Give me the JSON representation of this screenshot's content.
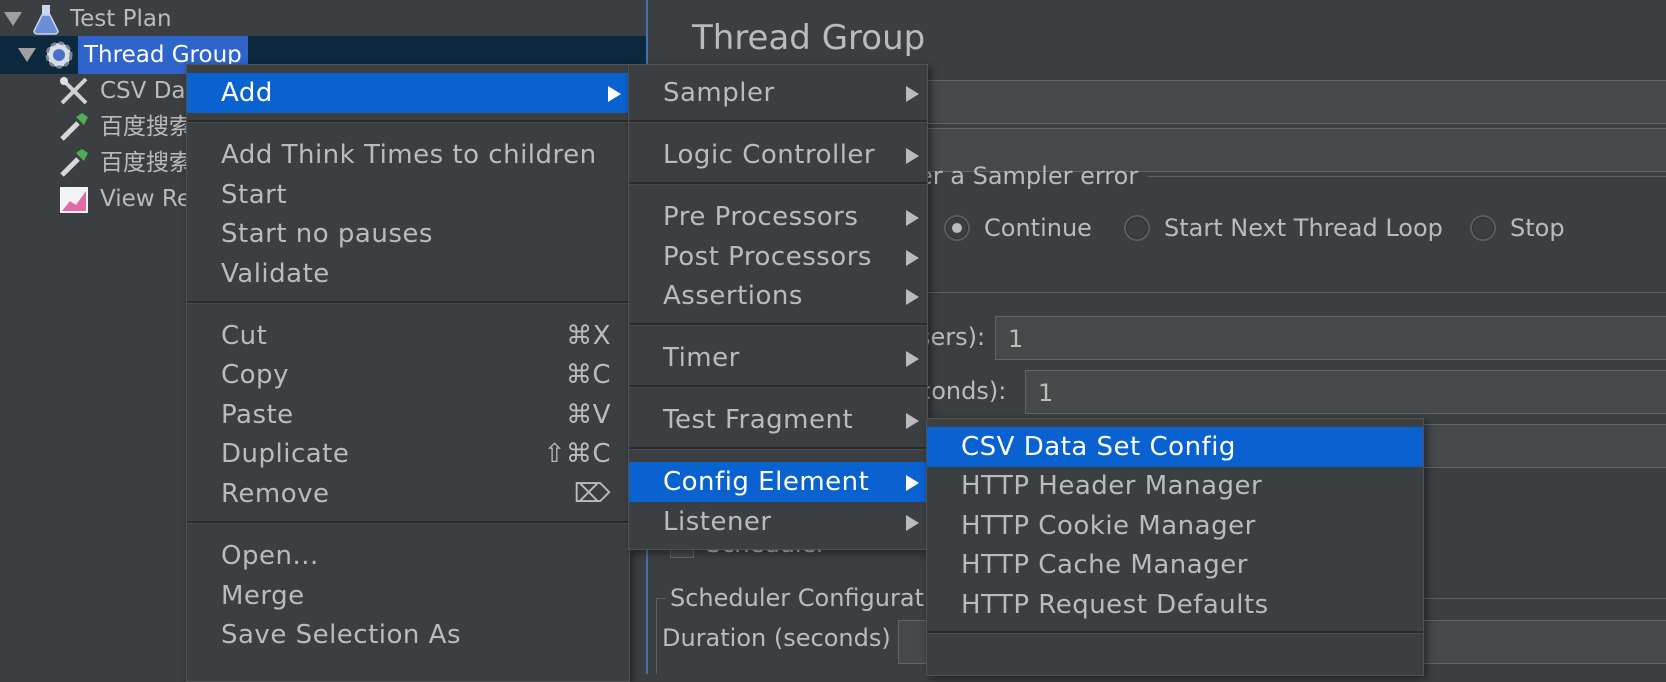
{
  "tree": {
    "items": [
      {
        "label": "Test Plan",
        "icon": "flask-icon"
      },
      {
        "label": "Thread Group",
        "icon": "gear-icon"
      },
      {
        "label": "CSV Dat",
        "icon": "tools-icon"
      },
      {
        "label": "百度搜索",
        "icon": "pipette-icon"
      },
      {
        "label": "百度搜索",
        "icon": "pipette-icon"
      },
      {
        "label": "View Re",
        "icon": "graph-icon"
      }
    ]
  },
  "panel": {
    "title": "Thread Group",
    "sampler_error_label": "er a Sampler error",
    "radio_continue": "Continue",
    "radio_next_loop": "Start Next Thread Loop",
    "radio_stop": "Stop",
    "threads_label": "sers):",
    "threads_value": "1",
    "rampup_label": "conds):",
    "rampup_value": "1",
    "scheduler_label": "Scheduler",
    "scheduler_config_label": "Scheduler Configurati",
    "duration_label": "Duration (seconds)"
  },
  "context_menu": {
    "add": "Add",
    "add_think_times": "Add Think Times to children",
    "start": "Start",
    "start_no_pauses": "Start no pauses",
    "validate": "Validate",
    "cut": "Cut",
    "cut_shortcut": "⌘X",
    "copy": "Copy",
    "copy_shortcut": "⌘C",
    "paste": "Paste",
    "paste_shortcut": "⌘V",
    "duplicate": "Duplicate",
    "duplicate_shortcut": "⇧⌘C",
    "remove": "Remove",
    "remove_shortcut": "⌦",
    "open": "Open...",
    "merge": "Merge",
    "save_selection_as": "Save Selection As"
  },
  "add_menu": {
    "sampler": "Sampler",
    "logic_controller": "Logic Controller",
    "pre_processors": "Pre Processors",
    "post_processors": "Post Processors",
    "assertions": "Assertions",
    "timer": "Timer",
    "test_fragment": "Test Fragment",
    "config_element": "Config Element",
    "listener": "Listener"
  },
  "config_menu": {
    "items": [
      "CSV Data Set Config",
      "HTTP Header Manager",
      "HTTP Cookie Manager",
      "HTTP Cache Manager",
      "HTTP Request Defaults"
    ]
  },
  "colors": {
    "background": "#3c3f41",
    "menu_highlight": "#0a62d0",
    "tree_selection": "#2f65ca",
    "text": "#bbbbbb"
  }
}
